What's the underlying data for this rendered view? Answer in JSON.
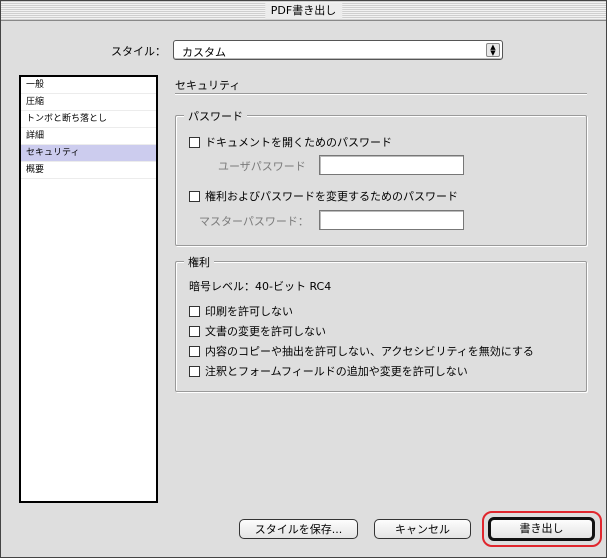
{
  "window": {
    "title": "PDF書き出し"
  },
  "style": {
    "label": "スタイル：",
    "value": "カスタム"
  },
  "sidebar": {
    "items": [
      {
        "label": "一般"
      },
      {
        "label": "圧縮"
      },
      {
        "label": "トンボと断ち落とし"
      },
      {
        "label": "詳細"
      },
      {
        "label": "セキュリティ"
      },
      {
        "label": "概要"
      }
    ],
    "selected": "セキュリティ"
  },
  "security": {
    "title": "セキュリティ",
    "password_group": {
      "title": "パスワード",
      "open_checkbox": "ドキュメントを開くためのパスワード",
      "user_label": "ユーザパスワード",
      "user_value": "",
      "perm_checkbox": "権利およびパスワードを変更するためのパスワード",
      "master_label": "マスターパスワード：",
      "master_value": ""
    },
    "permissions_group": {
      "title": "権利",
      "encryption": "暗号レベル：40-ビット RC4",
      "options": [
        {
          "label": "印刷を許可しない",
          "checked": false
        },
        {
          "label": "文書の変更を許可しない",
          "checked": false
        },
        {
          "label": "内容のコピーや抽出を許可しない、アクセシビリティを無効にする",
          "checked": false
        },
        {
          "label": "注釈とフォームフィールドの追加や変更を許可しない",
          "checked": false
        }
      ]
    }
  },
  "buttons": {
    "save_style": "スタイルを保存...",
    "cancel": "キャンセル",
    "export": "書き出し"
  },
  "colors": {
    "selection": "#ccccee",
    "highlight_ring": "#e0262d"
  }
}
